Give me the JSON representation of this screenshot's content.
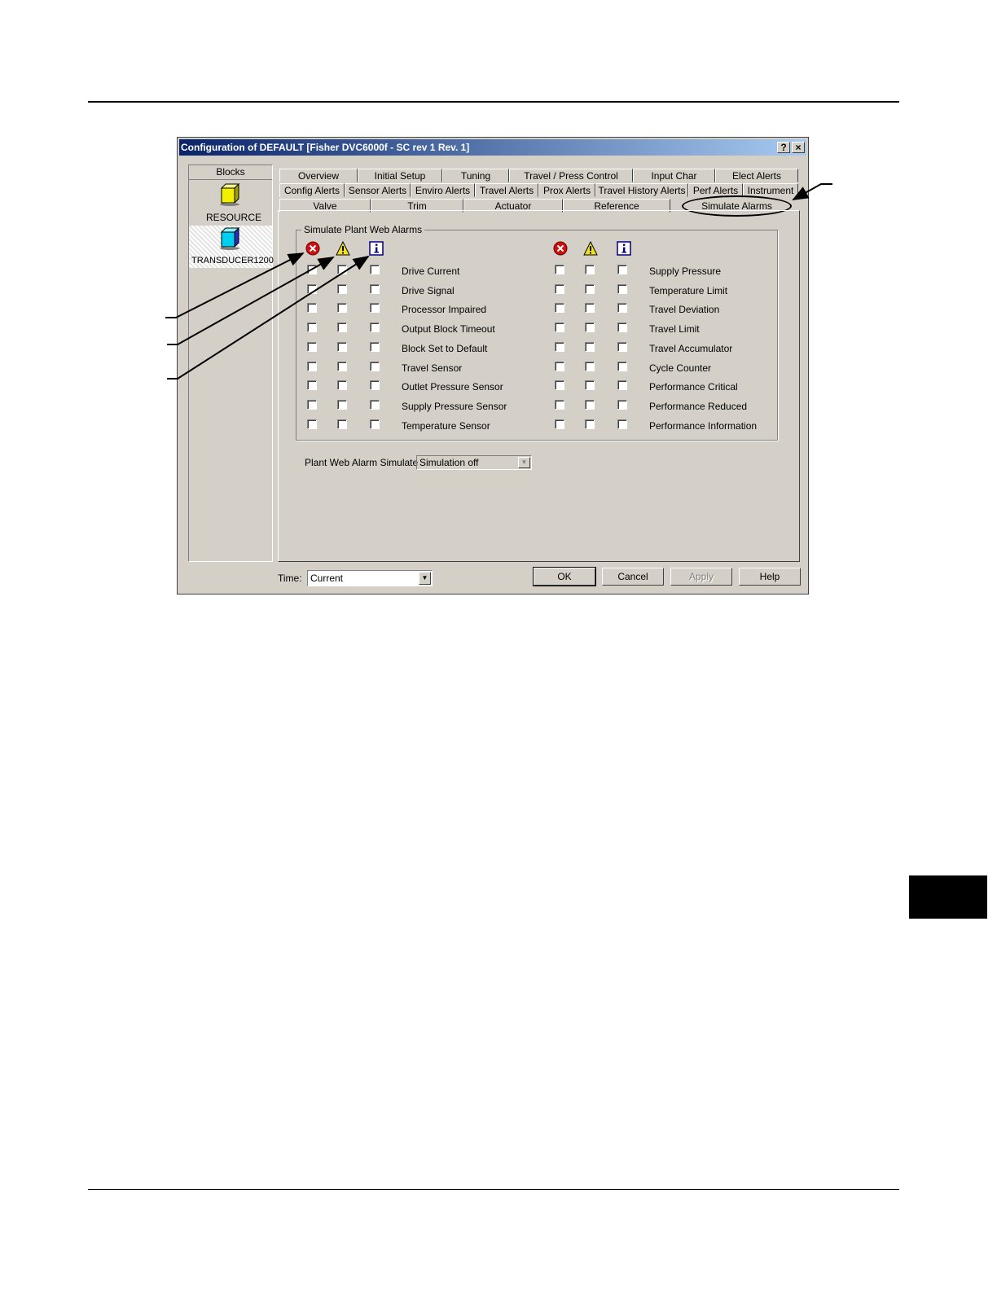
{
  "window": {
    "title": "Configuration of DEFAULT [Fisher DVC6000f - SC rev 1 Rev. 1]",
    "help_glyph": "?",
    "close_glyph": "×"
  },
  "blocks": {
    "header": "Blocks",
    "items": [
      {
        "label": "RESOURCE",
        "icon": "yellow-cube-icon",
        "color": "#f0f000"
      },
      {
        "label": "TRANSDUCER1200",
        "icon": "cyan-cube-icon",
        "color": "#00d0f0"
      }
    ]
  },
  "tabs": {
    "row1": [
      "Overview",
      "Initial Setup",
      "Tuning",
      "Travel / Press Control",
      "Input Char",
      "Elect Alerts"
    ],
    "row2": [
      "Config Alerts",
      "Sensor Alerts",
      "Enviro Alerts",
      "Travel Alerts",
      "Prox Alerts",
      "Travel History Alerts",
      "Perf Alerts",
      "Instrument"
    ],
    "row3": [
      "Valve",
      "Trim",
      "Actuator",
      "Reference",
      "Simulate Alarms"
    ],
    "active": "Simulate Alarms"
  },
  "group": {
    "title": "Simulate Plant Web Alarms",
    "icons": [
      "failed-alarm-icon",
      "maintenance-alarm-icon",
      "advisory-alarm-icon"
    ],
    "left_items": [
      "Drive Current",
      "Drive Signal",
      "Processor Impaired",
      "Output Block Timeout",
      "Block Set to Default",
      "Travel Sensor",
      "Outlet Pressure Sensor",
      "Supply Pressure Sensor",
      "Temperature Sensor"
    ],
    "right_items": [
      "Supply Pressure",
      "Temperature Limit",
      "Travel Deviation",
      "Travel Limit",
      "Travel Accumulator",
      "Cycle Counter",
      "Performance Critical",
      "Performance Reduced",
      "Performance Information"
    ]
  },
  "simulate": {
    "label": "Plant Web Alarm Simulate",
    "value": "Simulation off"
  },
  "footer": {
    "time_label": "Time:",
    "time_value": "Current",
    "ok": "OK",
    "cancel": "Cancel",
    "apply": "Apply",
    "help": "Help"
  },
  "colors": {
    "failed": "#d01010",
    "maintenance": "#f0e020",
    "advisory": "#000080",
    "titlebar": "#0a246a"
  }
}
